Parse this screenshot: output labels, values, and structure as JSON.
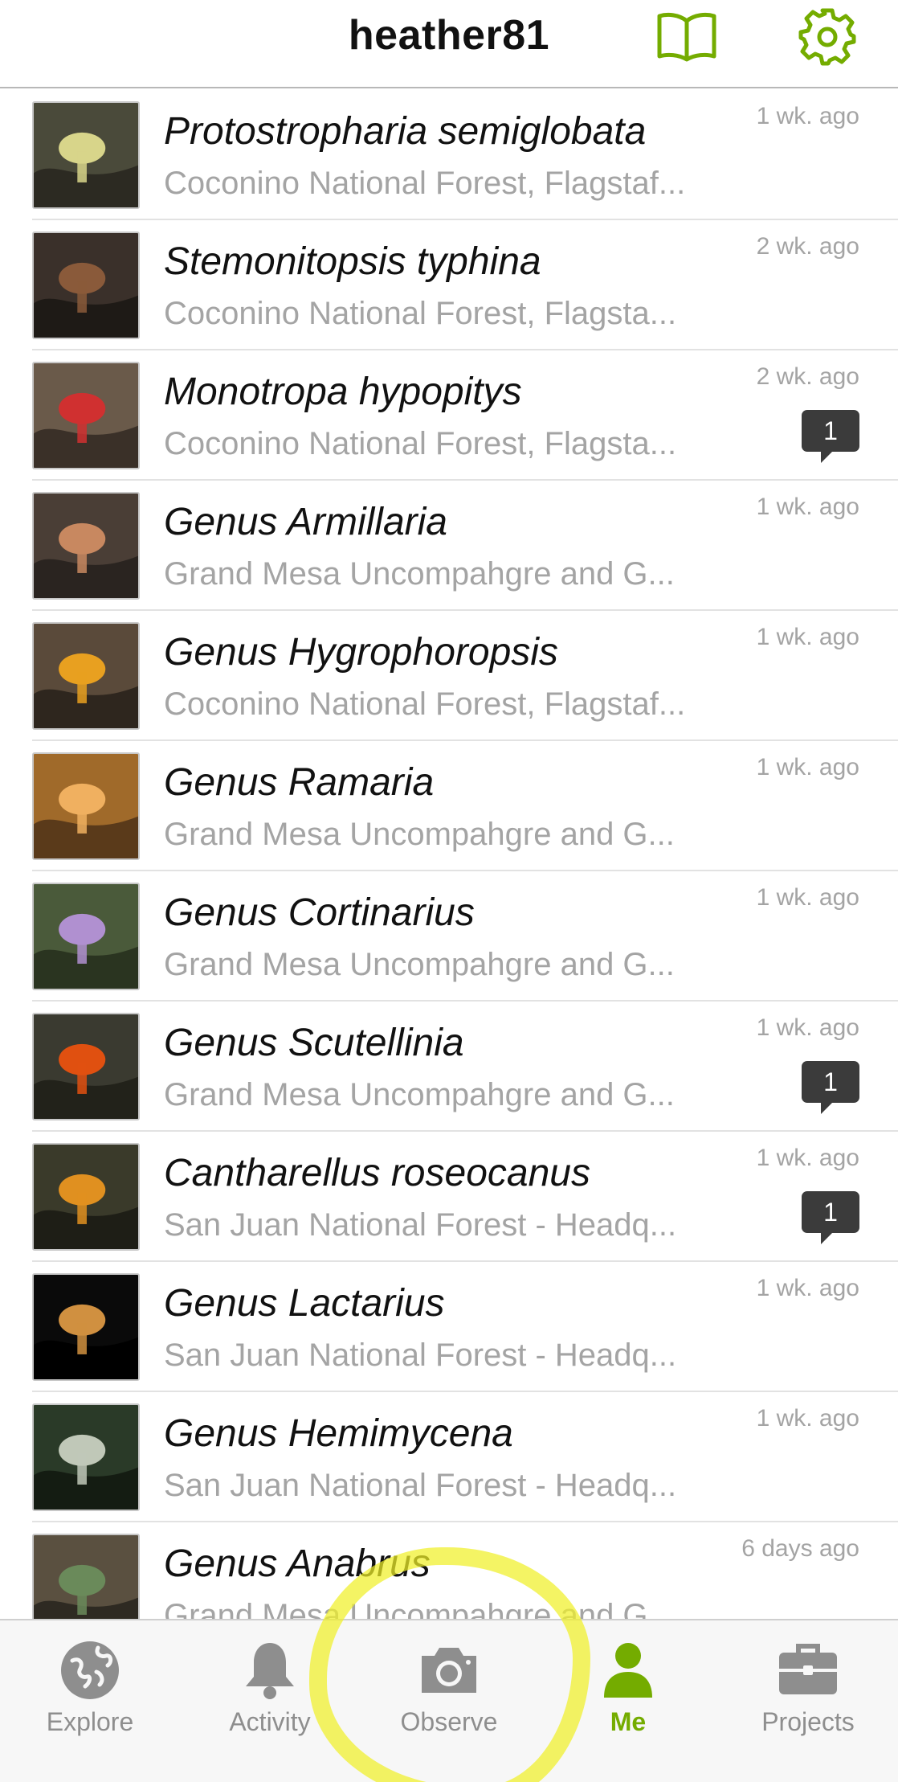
{
  "header": {
    "title": "heather81",
    "accent_color": "#74ac00",
    "icons": [
      "book-icon",
      "gear-icon"
    ]
  },
  "observations": [
    {
      "name": "Protostropharia semiglobata",
      "place": "Coconino National Forest, Flagstaf...",
      "time": "1 wk. ago",
      "comments": null
    },
    {
      "name": "Stemonitopsis typhina",
      "place": "Coconino National Forest, Flagsta...",
      "time": "2 wk. ago",
      "comments": null
    },
    {
      "name": "Monotropa hypopitys",
      "place": "Coconino National Forest, Flagsta...",
      "time": "2 wk. ago",
      "comments": "1"
    },
    {
      "name": "Genus Armillaria",
      "place": "Grand Mesa Uncompahgre and G...",
      "time": "1 wk. ago",
      "comments": null
    },
    {
      "name": "Genus Hygrophoropsis",
      "place": "Coconino National Forest, Flagstaf...",
      "time": "1 wk. ago",
      "comments": null
    },
    {
      "name": "Genus Ramaria",
      "place": "Grand Mesa Uncompahgre and G...",
      "time": "1 wk. ago",
      "comments": null
    },
    {
      "name": "Genus Cortinarius",
      "place": "Grand Mesa Uncompahgre and G...",
      "time": "1 wk. ago",
      "comments": null
    },
    {
      "name": "Genus Scutellinia",
      "place": "Grand Mesa Uncompahgre and G...",
      "time": "1 wk. ago",
      "comments": "1"
    },
    {
      "name": "Cantharellus roseocanus",
      "place": "San Juan National Forest - Headq...",
      "time": "1 wk. ago",
      "comments": "1"
    },
    {
      "name": "Genus Lactarius",
      "place": "San Juan National Forest - Headq...",
      "time": "1 wk. ago",
      "comments": null
    },
    {
      "name": "Genus Hemimycena",
      "place": "San Juan National Forest - Headq...",
      "time": "1 wk. ago",
      "comments": null
    },
    {
      "name": "Genus Anabrus",
      "place": "Grand Mesa Uncompahgre and G...",
      "time": "6 days ago",
      "comments": null
    }
  ],
  "tabbar": {
    "tabs": [
      {
        "label": "Explore",
        "icon": "globe-icon",
        "active": false
      },
      {
        "label": "Activity",
        "icon": "bell-icon",
        "active": false
      },
      {
        "label": "Observe",
        "icon": "camera-icon",
        "active": false
      },
      {
        "label": "Me",
        "icon": "person-icon",
        "active": true
      },
      {
        "label": "Projects",
        "icon": "briefcase-icon",
        "active": false
      }
    ],
    "active_color": "#74ac00",
    "inactive_color": "#8e8e8e"
  },
  "annotation": {
    "highlight_color": "#f0f028"
  }
}
